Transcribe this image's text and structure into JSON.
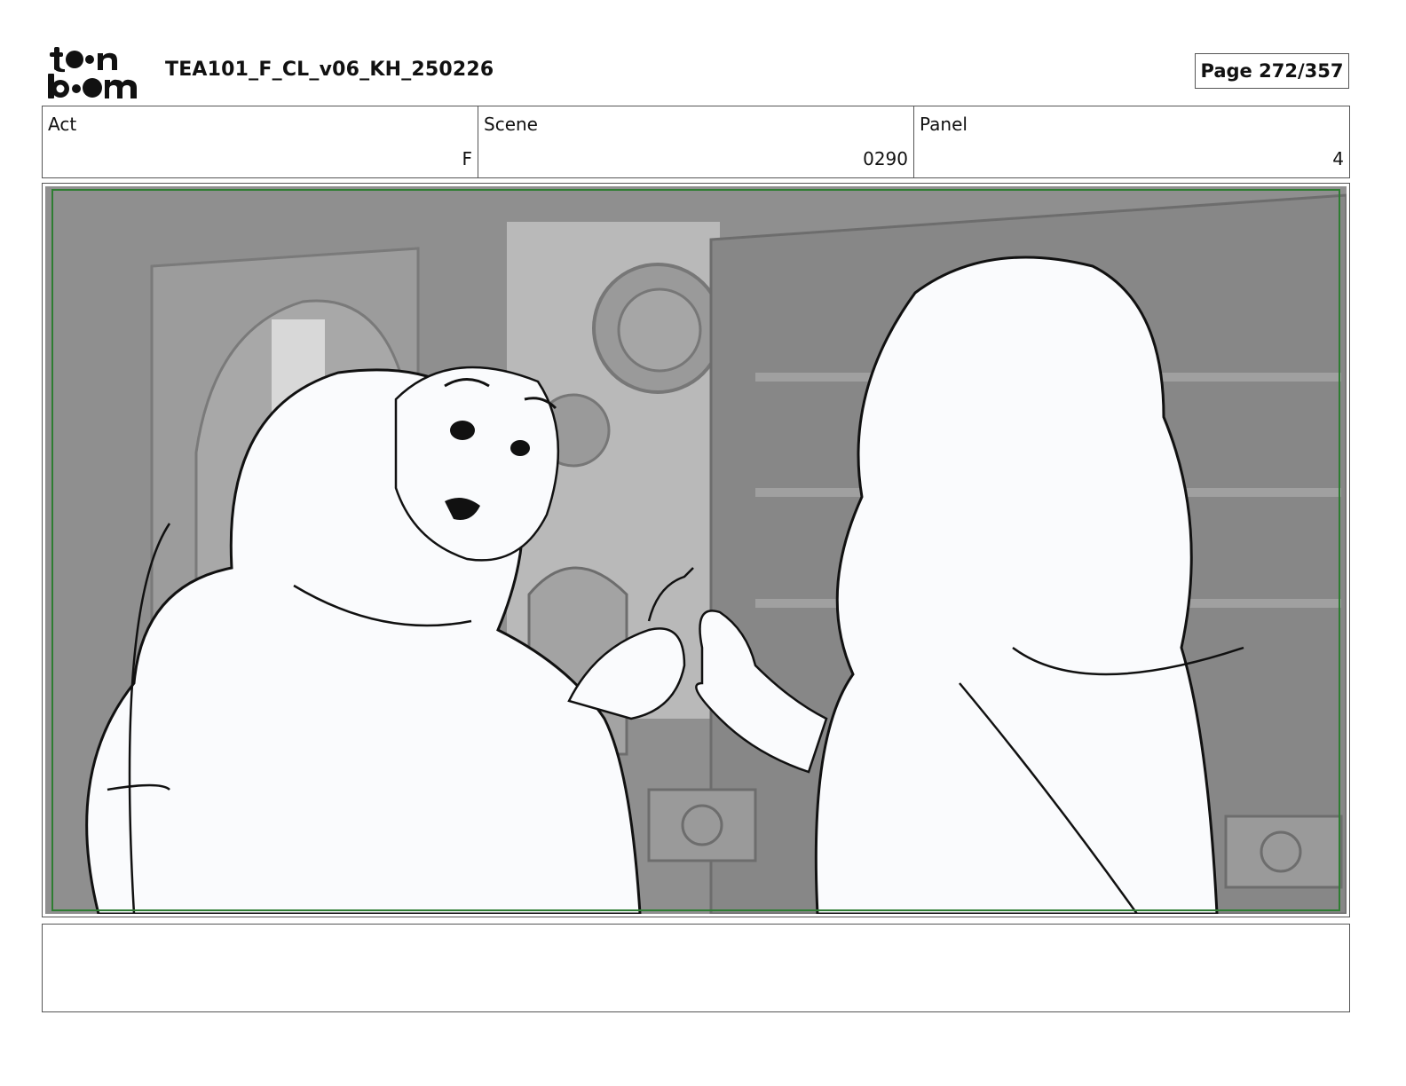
{
  "header": {
    "logo": "toon boom",
    "title": "TEA101_F_CL_v06_KH_250226",
    "page": "Page 272/357"
  },
  "info": {
    "act_label": "Act",
    "act_value": "F",
    "scene_label": "Scene",
    "scene_value": "0290",
    "panel_label": "Panel",
    "panel_value": "4"
  },
  "panel": {
    "icon": "storyboard-sketch",
    "safe_frame_color": "#2e7d32",
    "background_color": "#8f8f8f",
    "character_fill": "#fafbfd"
  },
  "notes": {
    "text": ""
  }
}
